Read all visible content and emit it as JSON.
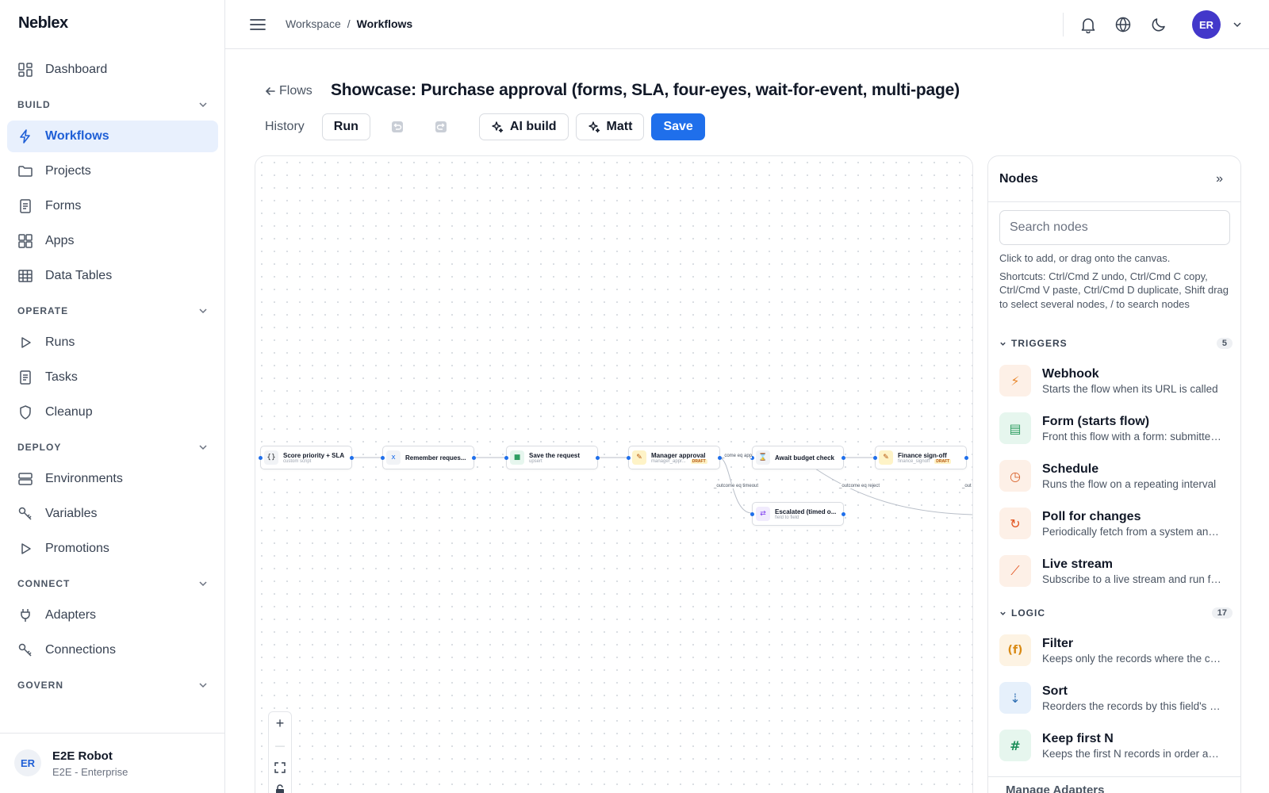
{
  "app": {
    "brand": "Neblex"
  },
  "sidebar": {
    "top_item": {
      "label": "Dashboard"
    },
    "sections": [
      {
        "title": "BUILD",
        "items": [
          {
            "label": "Workflows",
            "active": true
          },
          {
            "label": "Projects"
          },
          {
            "label": "Forms"
          },
          {
            "label": "Apps"
          },
          {
            "label": "Data Tables"
          }
        ]
      },
      {
        "title": "OPERATE",
        "items": [
          {
            "label": "Runs"
          },
          {
            "label": "Tasks"
          },
          {
            "label": "Cleanup"
          }
        ]
      },
      {
        "title": "DEPLOY",
        "items": [
          {
            "label": "Environments"
          },
          {
            "label": "Variables"
          },
          {
            "label": "Promotions"
          }
        ]
      },
      {
        "title": "CONNECT",
        "items": [
          {
            "label": "Adapters"
          },
          {
            "label": "Connections"
          }
        ]
      },
      {
        "title": "GOVERN",
        "items": []
      }
    ],
    "user": {
      "initials": "ER",
      "name": "E2E Robot",
      "org": "E2E - Enterprise"
    }
  },
  "topbar": {
    "breadcrumb": {
      "root": "Workspace",
      "separator": "/",
      "current": "Workflows"
    },
    "avatar_initials": "ER"
  },
  "header": {
    "back_label": "Flows",
    "title": "Showcase: Purchase approval (forms, SLA, four-eyes, wait-for-event, multi-page)"
  },
  "toolbar": {
    "history_label": "History",
    "run_label": "Run",
    "ai_build_label": "AI build",
    "matt_label": "Matt",
    "save_label": "Save"
  },
  "canvas": {
    "nodes": [
      {
        "id": "score",
        "title": "Score priority + SLA",
        "sub": "custom script",
        "icon": "{}",
        "badge": ""
      },
      {
        "id": "remember",
        "title": "Remember reques...",
        "sub": "",
        "icon": "x",
        "badge": ""
      },
      {
        "id": "save",
        "title": "Save the request",
        "sub": "upsert",
        "icon": "■",
        "badge": ""
      },
      {
        "id": "manager",
        "title": "Manager approval",
        "sub": "manager_appr...",
        "icon": "✎",
        "badge": "DRAFT"
      },
      {
        "id": "await",
        "title": "Await budget check",
        "sub": "",
        "icon": "⌛",
        "badge": ""
      },
      {
        "id": "finance",
        "title": "Finance sign-off",
        "sub": "finance_signoff",
        "icon": "✎",
        "badge": "DRAFT"
      },
      {
        "id": "escalated",
        "title": "Escalated (timed o...",
        "sub": "field to field",
        "icon": "⇄",
        "badge": ""
      }
    ],
    "edge_labels": {
      "approve": "_come eq app",
      "timeout": "_outcome eq timeout",
      "reject": "_outcome eq reject",
      "offscreen": "_out"
    },
    "zoom": {
      "in": "+",
      "out": "—"
    }
  },
  "panel": {
    "title": "Nodes",
    "collapse_glyph": "»",
    "search_placeholder": "Search nodes",
    "hint_1": "Click to add, or drag onto the canvas.",
    "hint_2": "Shortcuts: Ctrl/Cmd Z undo, Ctrl/Cmd C copy, Ctrl/Cmd V paste, Ctrl/Cmd D duplicate, Shift drag to select several nodes, / to search nodes",
    "categories": [
      {
        "label": "TRIGGERS",
        "count": "5",
        "items": [
          {
            "name": "Webhook",
            "desc": "Starts the flow when its URL is called",
            "icon": "⚡",
            "bg": "#fdf0e7",
            "fg": "#e8862a"
          },
          {
            "name": "Form (starts flow)",
            "desc": "Front this flow with a form: submitted answers start a run",
            "icon": "▤",
            "bg": "#e6f6ee",
            "fg": "#2f9e62"
          },
          {
            "name": "Schedule",
            "desc": "Runs the flow on a repeating interval",
            "icon": "◷",
            "bg": "#fdf0e7",
            "fg": "#d9622b"
          },
          {
            "name": "Poll for changes",
            "desc": "Periodically fetch from a system and start a run",
            "icon": "↻",
            "bg": "#fdf0e7",
            "fg": "#e2521d"
          },
          {
            "name": "Live stream",
            "desc": "Subscribe to a live stream and run for each event",
            "icon": "⟋",
            "bg": "#fdf0e7",
            "fg": "#e2521d"
          }
        ]
      },
      {
        "label": "LOGIC",
        "count": "17",
        "items": [
          {
            "name": "Filter",
            "desc": "Keeps only the records where the condition holds",
            "icon": "(f)",
            "bg": "#fdf3e3",
            "fg": "#d98a14"
          },
          {
            "name": "Sort",
            "desc": "Reorders the records by this field's values",
            "icon": "⇣",
            "bg": "#e6f0fb",
            "fg": "#2f6fb3"
          },
          {
            "name": "Keep first N",
            "desc": "Keeps the first N records in order and drops the rest",
            "icon": "#",
            "bg": "#e6f6ee",
            "fg": "#1d8f5a"
          }
        ]
      }
    ],
    "footer_label": "Manage Adapters"
  }
}
